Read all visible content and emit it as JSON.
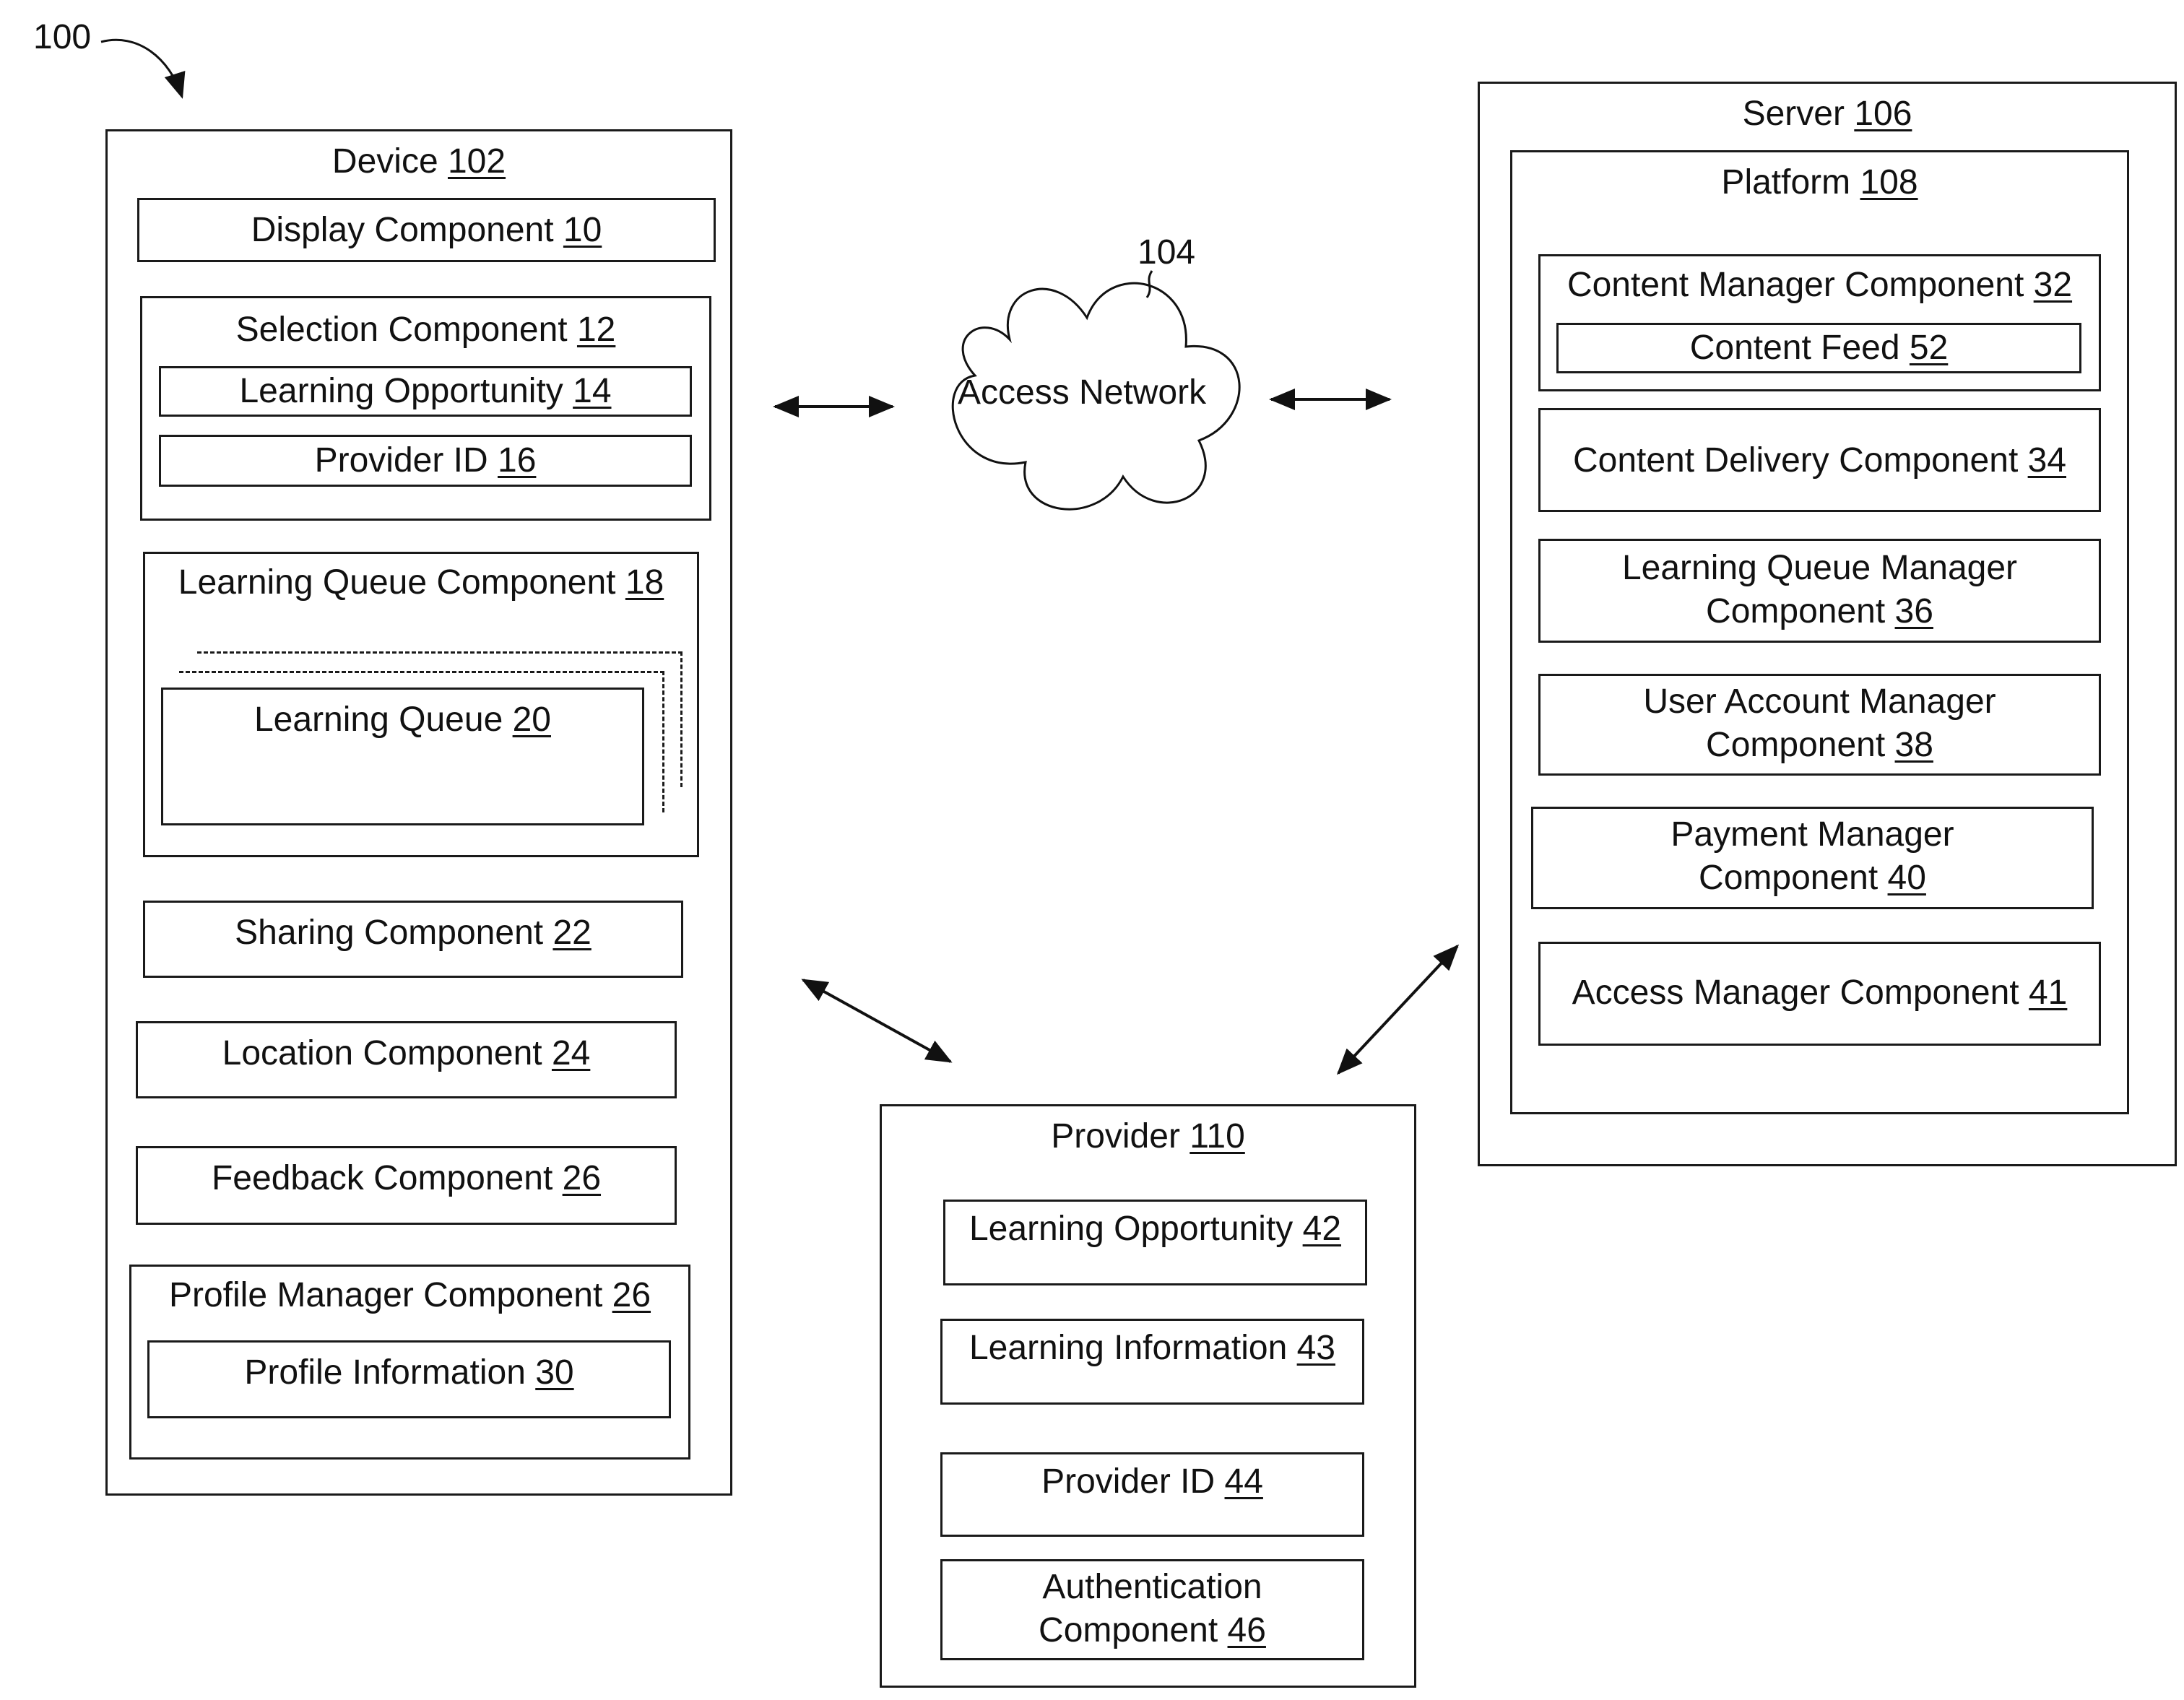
{
  "figure": {
    "ref": "100",
    "network": {
      "ref": "104",
      "label": "Access Network"
    }
  },
  "device": {
    "name": "Device",
    "num": "102",
    "display": {
      "name": "Display Component",
      "num": "10"
    },
    "selection": {
      "name": "Selection Component",
      "num": "12",
      "learning_opportunity": {
        "name": "Learning Opportunity",
        "num": "14"
      },
      "provider_id": {
        "name": "Provider ID",
        "num": "16"
      }
    },
    "learning_queue_component": {
      "name": "Learning Queue Component",
      "num": "18",
      "learning_queue": {
        "name": "Learning Queue",
        "num": "20"
      }
    },
    "sharing": {
      "name": "Sharing Component",
      "num": "22"
    },
    "location": {
      "name": "Location Component",
      "num": "24"
    },
    "feedback": {
      "name": "Feedback Component",
      "num": "26"
    },
    "profile_manager": {
      "name": "Profile Manager Component",
      "num": "26",
      "profile_information": {
        "name": "Profile Information",
        "num": "30"
      }
    }
  },
  "server": {
    "name": "Server",
    "num": "106",
    "platform": {
      "name": "Platform",
      "num": "108",
      "content_manager": {
        "name": "Content Manager Component",
        "num": "32",
        "content_feed": {
          "name": "Content Feed",
          "num": "52"
        }
      },
      "content_delivery": {
        "name": "Content Delivery Component",
        "num": "34"
      },
      "learning_queue_manager": {
        "line1": "Learning Queue Manager",
        "line2": "Component",
        "num": "36"
      },
      "user_account_manager": {
        "line1": "User Account Manager",
        "line2": "Component",
        "num": "38"
      },
      "payment_manager": {
        "line1": "Payment Manager",
        "line2": "Component",
        "num": "40"
      },
      "access_manager": {
        "name": "Access Manager Component",
        "num": "41"
      }
    }
  },
  "provider": {
    "name": "Provider",
    "num": "110",
    "learning_opportunity": {
      "name": "Learning Opportunity",
      "num": "42"
    },
    "learning_information": {
      "name": "Learning Information",
      "num": "43"
    },
    "provider_id": {
      "name": "Provider ID",
      "num": "44"
    },
    "authentication": {
      "line1": "Authentication",
      "line2": "Component",
      "num": "46"
    }
  },
  "connections": [
    {
      "from": "Device 102",
      "to": "Access Network 104",
      "type": "bidirectional"
    },
    {
      "from": "Access Network 104",
      "to": "Server 106",
      "type": "bidirectional"
    },
    {
      "from": "Device 102",
      "to": "Provider 110",
      "type": "bidirectional"
    },
    {
      "from": "Provider 110",
      "to": "Server 106",
      "type": "bidirectional"
    }
  ]
}
